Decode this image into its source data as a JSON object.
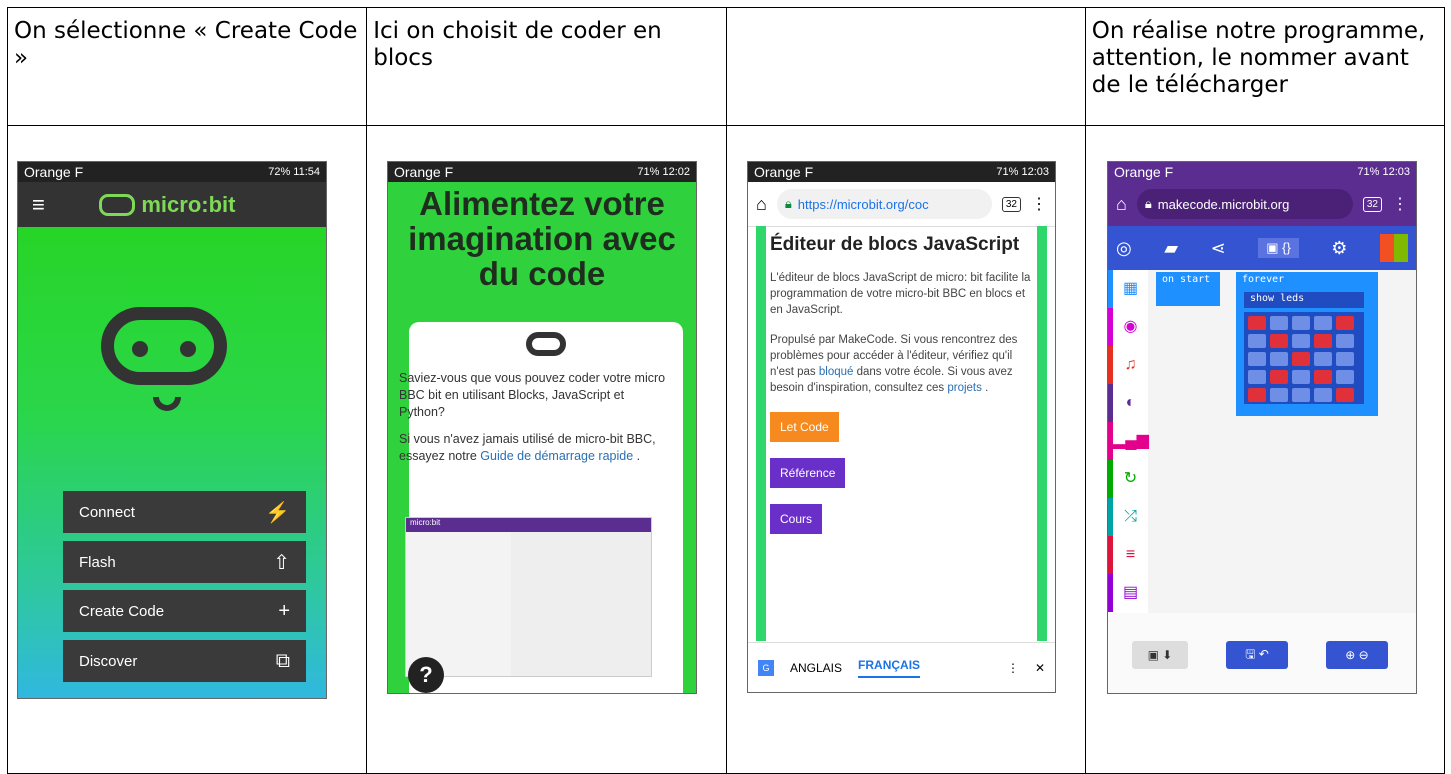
{
  "captions": [
    "On sélectionne « Create Code »",
    "Ici on choisit de coder en blocs",
    "",
    "On réalise notre programme, attention, le nommer avant de le télécharger"
  ],
  "phone1": {
    "carrier": "Orange F",
    "status": "72% 11:54",
    "logo": "micro:bit",
    "buttons": [
      {
        "label": "Connect",
        "icon": "plug-icon"
      },
      {
        "label": "Flash",
        "icon": "upload-icon"
      },
      {
        "label": "Create Code",
        "icon": "plus-icon"
      },
      {
        "label": "Discover",
        "icon": "external-link-icon"
      }
    ]
  },
  "phone2": {
    "carrier": "Orange F",
    "status": "71% 12:02",
    "headline": "Alimentez votre imagination avec du code",
    "para1": "Saviez-vous que vous pouvez coder votre micro BBC bit en utilisant Blocks, JavaScript et Python?",
    "para2_pre": "Si vous n'avez jamais utilisé de micro-bit BBC, essayez notre ",
    "para2_link": "Guide de démarrage rapide",
    "para2_post": " .",
    "thumb_title": "micro:bit"
  },
  "phone3": {
    "carrier": "Orange F",
    "status": "71% 12:03",
    "url": "https://microbit.org/coc",
    "tabs": "32",
    "heading": "Éditeur de blocs JavaScript",
    "p1": "L'éditeur de blocs JavaScript de micro: bit facilite la programmation de votre micro-bit BBC en blocs et en JavaScript.",
    "p2_pre": "Propulsé par MakeCode. Si vous rencontrez des problèmes pour accéder à l'éditeur, vérifiez qu'il n'est pas ",
    "p2_link1": "bloqué",
    "p2_mid": " dans votre école. Si vous avez besoin d'inspiration, consultez ces ",
    "p2_link2": "projets",
    "p2_post": " .",
    "btn1": "Let Code",
    "btn2": "Référence",
    "btn3": "Cours",
    "lang1": "ANGLAIS",
    "lang2": "FRANÇAIS"
  },
  "phone4": {
    "carrier": "Orange F",
    "status": "71% 12:03",
    "url": "makecode.microbit.org",
    "tabs": "32",
    "block_start": "on start",
    "block_forever": "forever",
    "block_leds": "show leds",
    "leds": [
      1,
      0,
      0,
      0,
      1,
      0,
      1,
      0,
      1,
      0,
      0,
      0,
      1,
      0,
      0,
      0,
      1,
      0,
      1,
      0,
      1,
      0,
      0,
      0,
      1
    ]
  },
  "colors": {
    "green": "#2fd23c",
    "makecode_blue": "#3454d1",
    "purple": "#5c2d91",
    "orange": "#f68a1e"
  }
}
